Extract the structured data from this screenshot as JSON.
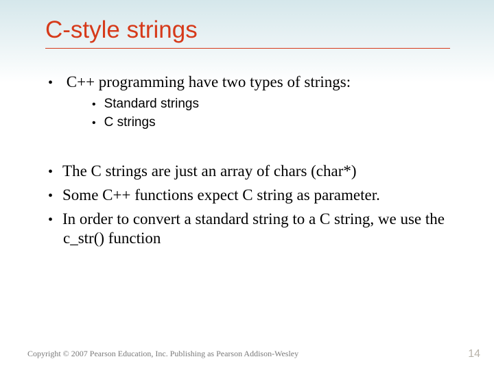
{
  "title": "C-style strings",
  "bullets": {
    "b1": "C++ programming have two types of strings:",
    "b1a": "Standard strings",
    "b1b": "C strings",
    "b2": "The C strings are just an array of chars (char*)",
    "b3": "Some C++ functions expect C string as parameter.",
    "b4": "In order to convert a standard string to a C string, we use the c_str() function"
  },
  "footer": "Copyright © 2007 Pearson Education, Inc. Publishing as Pearson Addison-Wesley",
  "page_number": "14"
}
